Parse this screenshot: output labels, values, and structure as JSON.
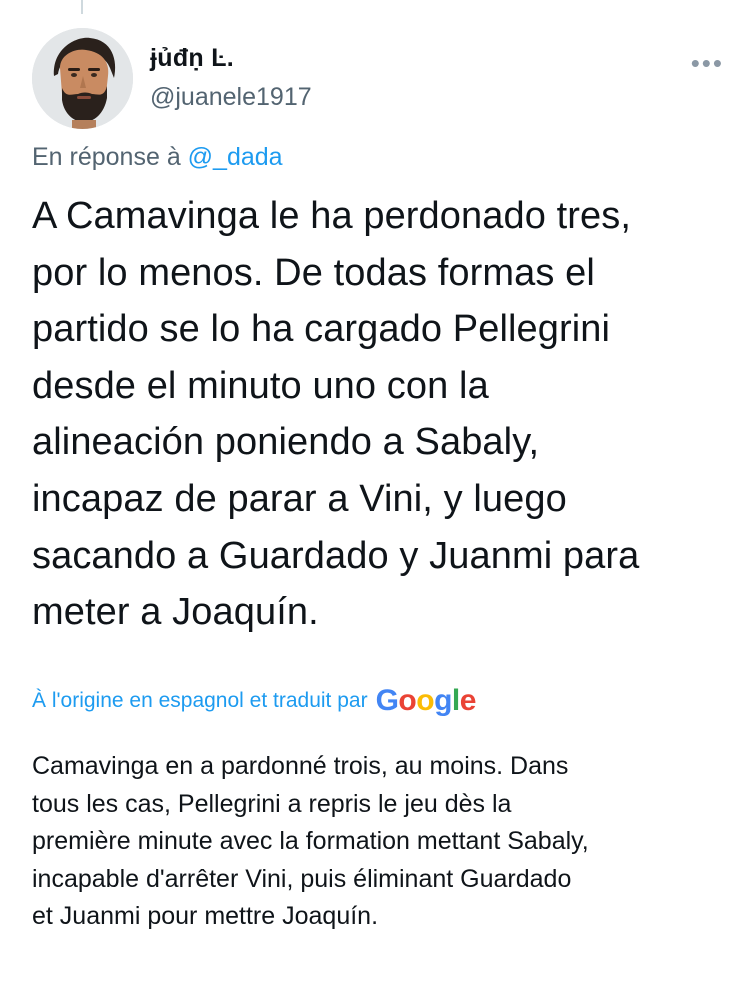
{
  "user": {
    "display_name": "ɉủđṇ Ŀ.",
    "handle": "@juanele1917"
  },
  "header": {
    "more_label": "•••"
  },
  "reply": {
    "prefix": "En réponse à",
    "mention": "@_dada"
  },
  "tweet": {
    "lines": [
      "A Camavinga le ha perdonado tres,",
      "por lo menos. De todas formas el",
      "partido se lo ha cargado Pellegrini",
      "desde el minuto uno con la",
      "alineación poniendo a Sabaly,",
      "incapaz de parar a Vini, y luego",
      "sacando a Guardado y Juanmi para",
      "meter a Joaquín."
    ]
  },
  "translation": {
    "label": "À l'origine en espagnol et traduit par",
    "provider_letters": [
      "G",
      "o",
      "o",
      "g",
      "l",
      "e"
    ],
    "provider_colors": [
      "#4285f4",
      "#ea4335",
      "#fbbc05",
      "#4285f4",
      "#34a853",
      "#ea4335"
    ],
    "lines": [
      "Camavinga en a pardonné trois, au moins. Dans",
      "tous les cas, Pellegrini a repris le jeu dès la",
      "première minute avec la formation mettant Sabaly,",
      "incapable d'arrêter Vini, puis éliminant Guardado",
      "et Juanmi pour mettre Joaquín."
    ]
  },
  "colors": {
    "link": "#1d9bf0",
    "secondary_text": "#536471",
    "primary_text": "#0f1419"
  }
}
